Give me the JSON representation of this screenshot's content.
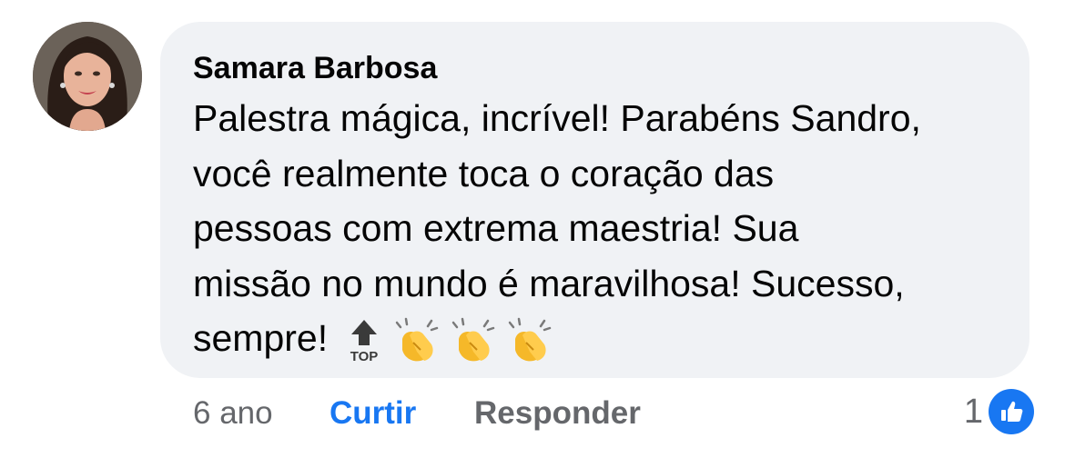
{
  "comment": {
    "author": "Samara Barbosa",
    "lines": [
      "Palestra mágica, incrível! Parabéns Sandro,",
      "você realmente toca o coração das",
      "pessoas com extrema maestria! Sua",
      "missão no mundo é maravilhosa! Sucesso,",
      "sempre!"
    ],
    "emojis": [
      "top-arrow-icon",
      "clapping-hands-icon",
      "clapping-hands-icon",
      "clapping-hands-icon"
    ],
    "top_emoji_text": "TOP"
  },
  "footer": {
    "time": "6 ano",
    "like_label": "Curtir",
    "reply_label": "Responder"
  },
  "reactions": {
    "count": "1",
    "type": "like-icon"
  },
  "colors": {
    "bubble": "#f0f2f5",
    "accent": "#1877f2",
    "secondary_text": "#65676b",
    "primary_text": "#050505"
  }
}
